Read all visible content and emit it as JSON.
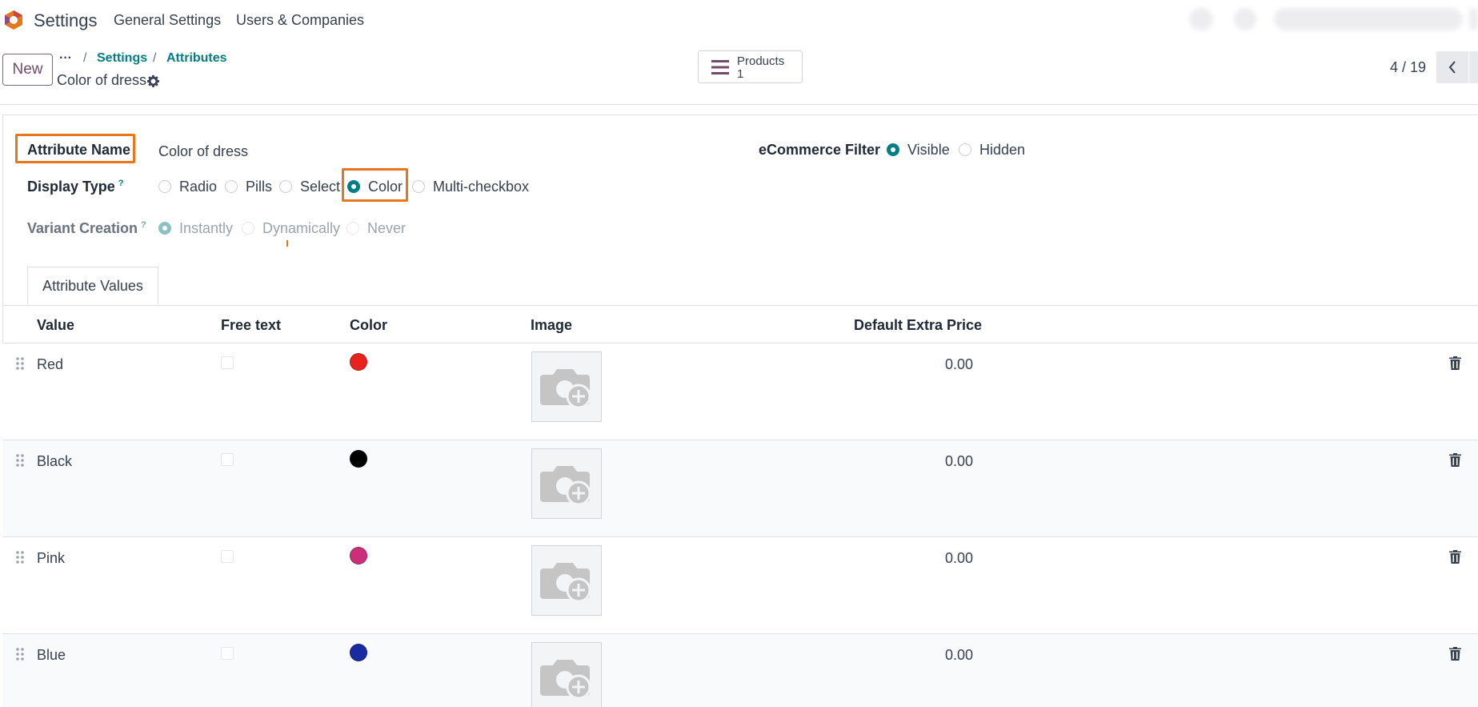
{
  "navbar": {
    "app_name": "Settings",
    "menu": [
      "General Settings",
      "Users & Companies"
    ]
  },
  "control_panel": {
    "new_label": "New",
    "breadcrumb_dots": "···",
    "breadcrumbs": [
      "Settings",
      "Attributes"
    ],
    "separator": "/",
    "record_title": "Color of dress",
    "smart_button": {
      "label": "Products",
      "count": "1"
    },
    "pager": "4 / 19"
  },
  "form": {
    "attribute_name_label": "Attribute Name",
    "attribute_name_value": "Color of dress",
    "display_type_label": "Display Type",
    "display_type_help": "?",
    "display_type_options": [
      "Radio",
      "Pills",
      "Select",
      "Color",
      "Multi-checkbox"
    ],
    "display_type_selected": "Color",
    "variant_creation_label": "Variant Creation",
    "variant_creation_help": "?",
    "variant_creation_options": [
      "Instantly",
      "Dynamically",
      "Never"
    ],
    "variant_creation_selected": "Instantly",
    "ecommerce_filter_label": "eCommerce Filter",
    "ecommerce_filter_options": [
      "Visible",
      "Hidden"
    ],
    "ecommerce_filter_selected": "Visible"
  },
  "tabs": [
    "Attribute Values"
  ],
  "table": {
    "headers": [
      "Value",
      "Free text",
      "Color",
      "Image",
      "Default Extra Price"
    ],
    "rows": [
      {
        "value": "Red",
        "free_text": false,
        "color": "#e8231f",
        "price": "0.00"
      },
      {
        "value": "Black",
        "free_text": false,
        "color": "#000000",
        "price": "0.00"
      },
      {
        "value": "Pink",
        "free_text": false,
        "color": "#cc2f7a",
        "price": "0.00"
      },
      {
        "value": "Blue",
        "free_text": false,
        "color": "#1a2aa0",
        "price": "0.00"
      }
    ]
  },
  "colors": {
    "brand": "#714b67",
    "accent": "#017e84",
    "highlight": "#e8761f"
  },
  "icons": {
    "logo": "odoo-logo-icon",
    "record_settings": "gear-icon",
    "smart_button": "list-icon",
    "pager_prev": "chevron-left-icon",
    "row_handle": "drag-handle-icon",
    "image_placeholder": "camera-add-icon",
    "row_delete": "trash-icon"
  }
}
